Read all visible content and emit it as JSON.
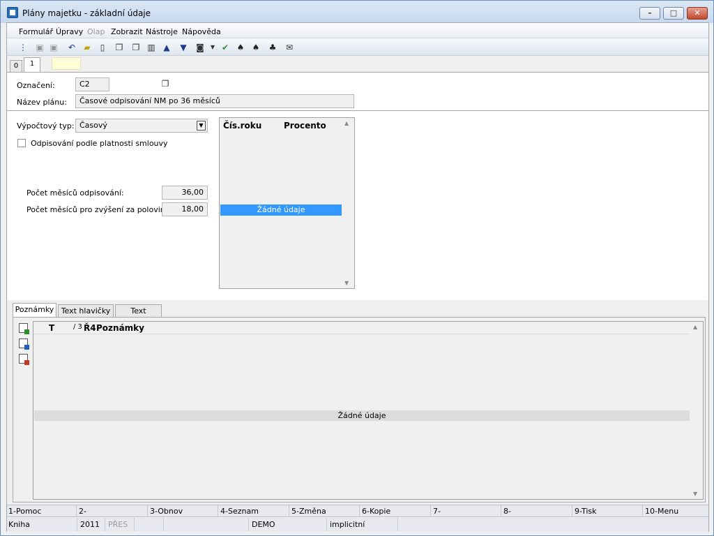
{
  "window": {
    "title": "Plány majetku - základní údaje",
    "min_symbol": "–",
    "max_symbol": "□",
    "close_symbol": "✕"
  },
  "menu": [
    "Formulář",
    "Úpravy",
    "Olap",
    "Zobrazit",
    "Nástroje",
    "Nápověda"
  ],
  "tabs_top": [
    "0",
    "1"
  ],
  "form": {
    "oznaceni_label": "Označení:",
    "oznaceni_value": "C2",
    "nazev_label": "Název plánu:",
    "nazev_value": "Časové odpisování NM po 36 měsíců",
    "vypoctovy_label": "Výpočtový typ:",
    "vypoctovy_value": "Časový",
    "odpis_checkbox_label": "Odpisování podle platnosti smlouvy",
    "pocet_mesicu_label": "Počet měsíců odpisování:",
    "pocet_mesicu_value": "36,00",
    "pocet_zvyseni_label": "Počet měsíců pro zvýšení za polovinou:",
    "pocet_zvyseni_value": "18,00"
  },
  "year_grid": {
    "col1": "Čís.roku",
    "col2": "Procento",
    "empty": "Žádné údaje"
  },
  "bottom_tabs": [
    "Poznámky",
    "Text hlavičky",
    "Text patičky"
  ],
  "notes_grid": {
    "col_t": "T",
    "col_3": "/ 3",
    "col_r": "Ř4",
    "col_notes": "Poznámky",
    "empty": "Žádné údaje"
  },
  "fkeys": [
    "1-Pomoc",
    "2-",
    "3-Obnov",
    "4-Seznam",
    "5-Změna",
    "6-Kopie",
    "7-",
    "8-",
    "9-Tisk",
    "10-Menu"
  ],
  "status": {
    "kniha": "Kniha",
    "rok": "2011",
    "pres": "PŘES",
    "firma": "DEMO",
    "mode": "implicitní"
  }
}
